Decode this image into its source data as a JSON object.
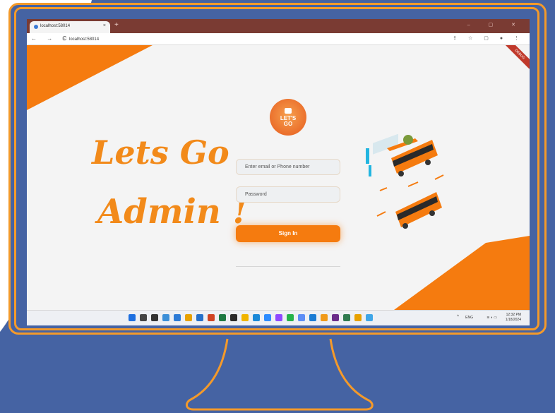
{
  "browser": {
    "tab_title": "localhost:58014",
    "tab_close": "×",
    "new_tab": "+",
    "url": "localhost:58014",
    "nav_buttons": "← → C",
    "window_controls": "– ▢ ✕",
    "addr_icons": "⇪ ☆ ▢ ●  ⋮"
  },
  "page": {
    "headline_line1": "Lets Go",
    "headline_line2": "Admin !",
    "logo_text_line1": "LET'S",
    "logo_text_line2": "GO",
    "email_placeholder": "Enter email or Phone number",
    "password_placeholder": "Password",
    "signin_label": "Sign In",
    "debug_ribbon": "DEBUG"
  },
  "taskbar": {
    "icons": [
      "windows-start-icon",
      "search-icon",
      "taskview-icon",
      "widgets-icon",
      "store-icon",
      "chrome-icon",
      "outlook-icon",
      "powerpoint-icon",
      "excel-icon",
      "terminal-icon",
      "files-icon",
      "edge-icon",
      "zoom-icon",
      "messenger-icon",
      "whatsapp-icon",
      "android-icon",
      "vscode-icon",
      "app-icon",
      "obs-icon",
      "notepad-icon",
      "chrome2-icon",
      "flutter-icon"
    ],
    "icon_colors": [
      "#1d6fe0",
      "#444444",
      "#333333",
      "#3c8fd8",
      "#2d7bd6",
      "#e8a100",
      "#2670c9",
      "#d04423",
      "#1f7a44",
      "#2a2a2a",
      "#f0b400",
      "#1a88d8",
      "#2d8cff",
      "#8f49ff",
      "#25b34a",
      "#5c8df6",
      "#1a7bd4",
      "#f09a1a",
      "#6a2d8a",
      "#2f7a50",
      "#e8a100",
      "#3fa6e8"
    ],
    "tray_chevron": "^",
    "lang": "ENG",
    "tray_icons": "≋ ◖ ▭",
    "time": "12:32 PM",
    "date": "1/18/2024"
  },
  "colors": {
    "accent": "#f57b0f",
    "frame": "#f49a2a",
    "background_blue": "#4563a3"
  }
}
